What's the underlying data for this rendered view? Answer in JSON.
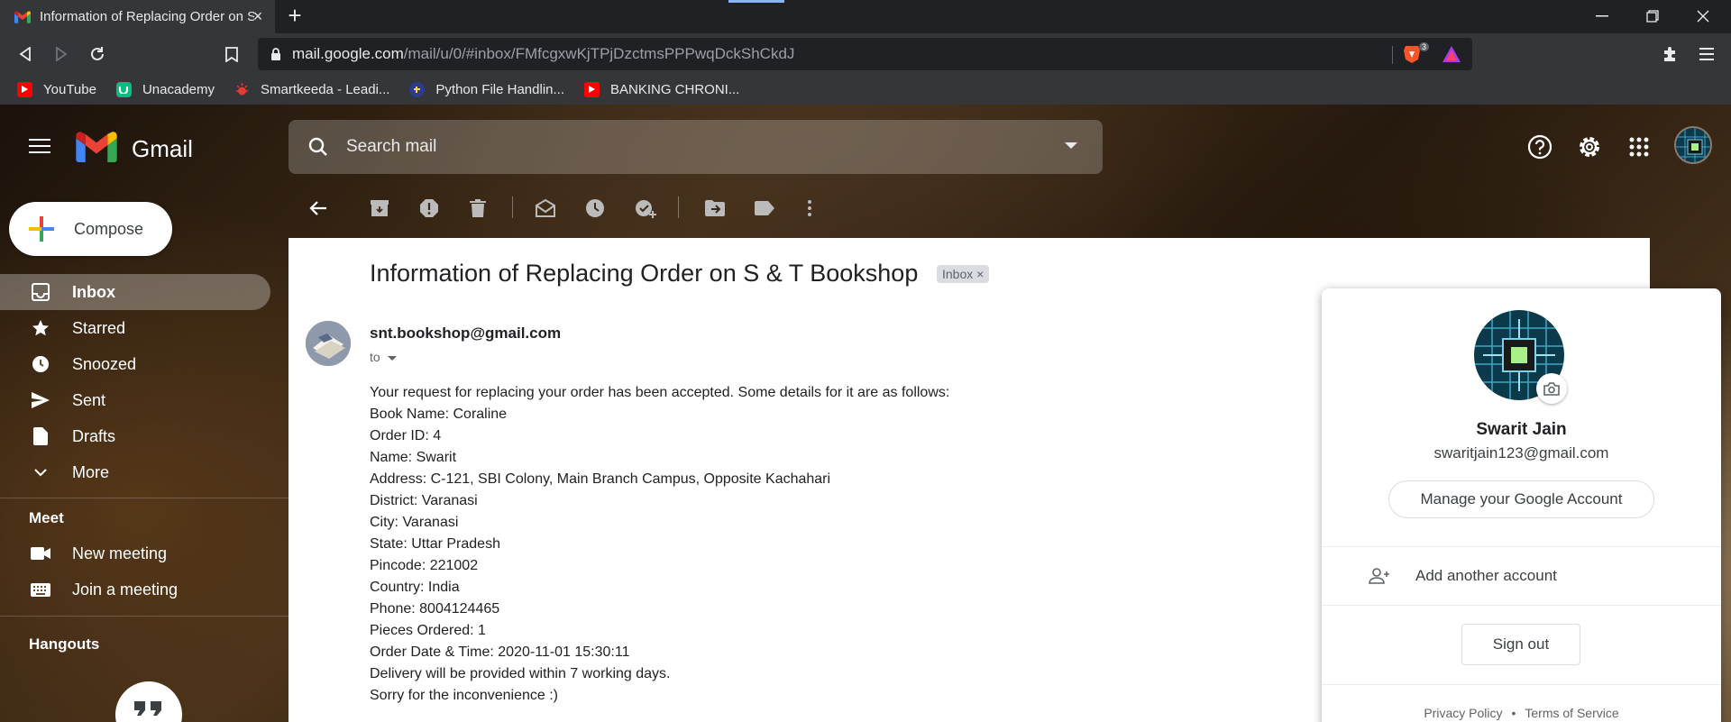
{
  "browser": {
    "tab_title": "Information of Replacing Order on S & T Bookshop",
    "url_host": "mail.google.com",
    "url_path": "/mail/u/0/#inbox/FMfcgxwKjTPjDzctmsPPPwqDckShCkdJ",
    "brave_badge": "3",
    "bookmarks": [
      {
        "label": "YouTube",
        "icon": "youtube-icon"
      },
      {
        "label": "Unacademy",
        "icon": "unacademy-icon"
      },
      {
        "label": "Smartkeeda - Leadi...",
        "icon": "smartkeeda-icon"
      },
      {
        "label": "Python File Handlin...",
        "icon": "python-icon"
      },
      {
        "label": "BANKING CHRONI...",
        "icon": "youtube-icon"
      }
    ]
  },
  "gmail": {
    "brand": "Gmail",
    "search_placeholder": "Search mail",
    "compose_label": "Compose",
    "nav": [
      {
        "label": "Inbox",
        "icon": "inbox-icon",
        "active": true
      },
      {
        "label": "Starred",
        "icon": "star-icon"
      },
      {
        "label": "Snoozed",
        "icon": "clock-icon"
      },
      {
        "label": "Sent",
        "icon": "send-icon"
      },
      {
        "label": "Drafts",
        "icon": "draft-icon"
      },
      {
        "label": "More",
        "icon": "chevron-down-icon"
      }
    ],
    "meet": {
      "title": "Meet",
      "items": [
        {
          "label": "New meeting",
          "icon": "video-icon"
        },
        {
          "label": "Join a meeting",
          "icon": "keyboard-icon"
        }
      ]
    },
    "hangouts_title": "Hangouts"
  },
  "email": {
    "subject": "Information of Replacing Order on S & T Bookshop",
    "label": "Inbox",
    "sender": "snt.bookshop@gmail.com",
    "to": "to",
    "body_lines": [
      "Your request for replacing your order has been accepted. Some details for it are as follows:",
      "Book Name: Coraline",
      "Order ID: 4",
      "Name: Swarit",
      "Address: C-121, SBI Colony, Main Branch Campus, Opposite Kachahari",
      "District: Varanasi",
      "City: Varanasi",
      "State: Uttar Pradesh",
      "Pincode: 221002",
      "Country: India",
      "Phone: 8004124465",
      "Pieces Ordered: 1",
      "Order Date & Time: 2020-11-01 15:30:11",
      "Delivery will be provided within 7 working days.",
      "Sorry for the inconvenience :)"
    ]
  },
  "account": {
    "name": "Swarit Jain",
    "email": "swaritjain123@gmail.com",
    "manage_label": "Manage your Google Account",
    "add_account_label": "Add another account",
    "sign_out_label": "Sign out",
    "privacy_label": "Privacy Policy",
    "footer_dot": "•",
    "terms_label": "Terms of Service"
  }
}
